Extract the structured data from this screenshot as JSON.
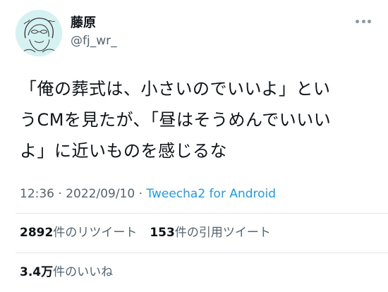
{
  "user": {
    "display_name": "藤原",
    "handle": "@fj_wr_",
    "avatar_icon": "avatar-illustration"
  },
  "tweet": {
    "lines": [
      "「俺の葬式は、小さいのでいいよ」とい",
      "うCMを見たが、「昼はそうめんでいいい",
      "よ」に近いものを感じるな"
    ],
    "timestamp": "12:36 · 2022/09/10 · ",
    "source": "Tweecha2 for Android"
  },
  "stats": {
    "retweets_count": "2892",
    "retweets_label": "件のリツイート",
    "quotes_count": "153",
    "quotes_label": "件の引用ツイート",
    "likes_count": "3.4万",
    "likes_label": "件のいいね"
  },
  "colors": {
    "text": "#0f1419",
    "secondary": "#536471",
    "link": "#1d9bf0",
    "avatar_bg": "#d6f1f1"
  }
}
